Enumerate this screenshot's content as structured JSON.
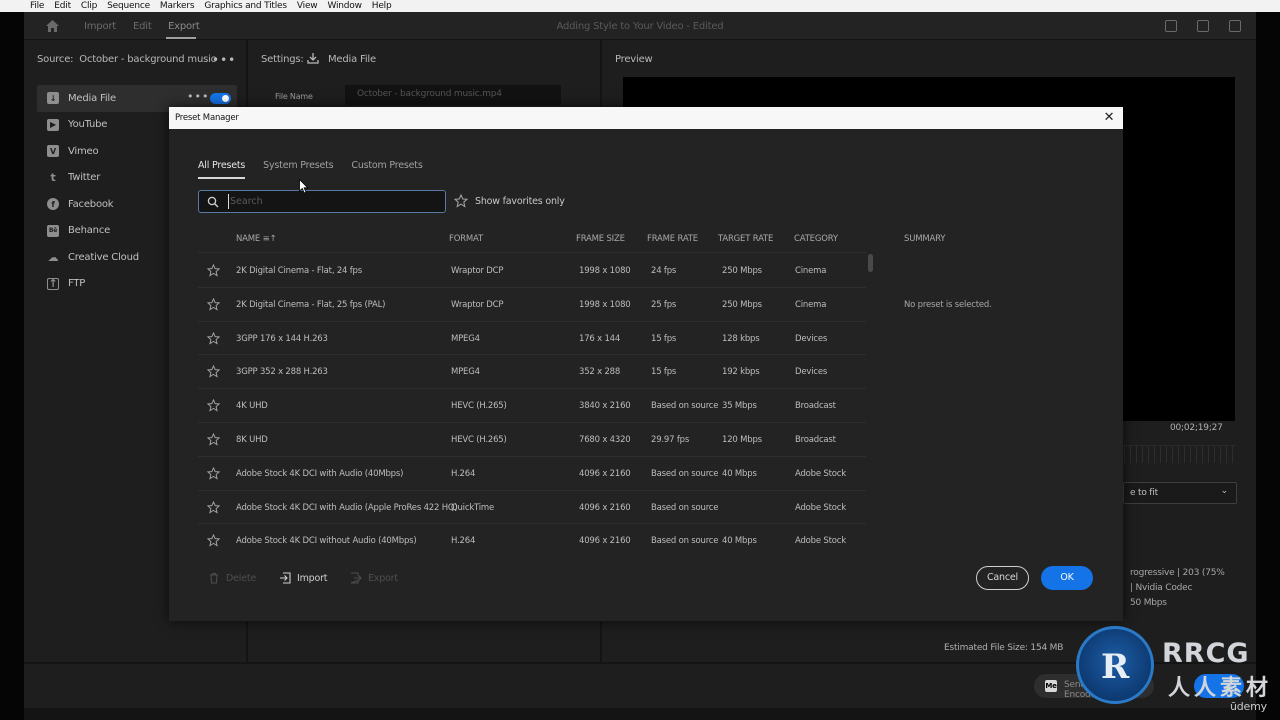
{
  "menubar": [
    "File",
    "Edit",
    "Clip",
    "Sequence",
    "Markers",
    "Graphics and Titles",
    "View",
    "Window",
    "Help"
  ],
  "topbar": {
    "tabs": [
      "Import",
      "Edit",
      "Export"
    ],
    "title": "Adding Style to Your Video - Edited"
  },
  "source": {
    "label": "Source:",
    "name": "October - background music",
    "destinations": [
      {
        "label": "Media File",
        "icon": "download-icon",
        "glyph": "↓"
      },
      {
        "label": "YouTube",
        "icon": "youtube-icon",
        "glyph": "▶"
      },
      {
        "label": "Vimeo",
        "icon": "vimeo-icon",
        "glyph": "V"
      },
      {
        "label": "Twitter",
        "icon": "twitter-icon",
        "glyph": "t"
      },
      {
        "label": "Facebook",
        "icon": "facebook-icon",
        "glyph": "f"
      },
      {
        "label": "Behance",
        "icon": "behance-icon",
        "glyph": "Bē"
      },
      {
        "label": "Creative Cloud",
        "icon": "creative-cloud-icon",
        "glyph": "☁"
      },
      {
        "label": "FTP",
        "icon": "ftp-upload-icon",
        "glyph": "↑"
      }
    ]
  },
  "settings": {
    "label": "Settings:",
    "value": "Media File",
    "file_name_label": "File Name",
    "file_name": "October - background music.mp4"
  },
  "preview": {
    "label": "Preview",
    "timecode": "00;02;19;27",
    "fit": "e to fit",
    "summary_lines": [
      "rogressive | 203 (75%",
      "| Nvidia Codec",
      "50 Mbps"
    ],
    "estimated_size": "Estimated File Size:   154 MB"
  },
  "bottombar": {
    "send_label": "Send to Media Encoder",
    "export_label": "Export"
  },
  "dialog": {
    "title": "Preset Manager",
    "tabs": [
      "All Presets",
      "System Presets",
      "Custom Presets"
    ],
    "search_placeholder": "Search",
    "favorites_label": "Show favorites only",
    "columns": {
      "name": "NAME ≡↑",
      "format": "FORMAT",
      "frame_size": "FRAME SIZE",
      "frame_rate": "FRAME RATE",
      "target_rate": "TARGET RATE",
      "category": "CATEGORY"
    },
    "summary_header": "SUMMARY",
    "summary_text": "No preset is selected.",
    "rows": [
      {
        "name": "2K Digital Cinema - Flat, 24 fps",
        "format": "Wraptor DCP",
        "size": "1998 x 1080",
        "rate": "24 fps",
        "target": "250 Mbps",
        "category": "Cinema"
      },
      {
        "name": "2K Digital Cinema - Flat, 25 fps (PAL)",
        "format": "Wraptor DCP",
        "size": "1998 x 1080",
        "rate": "25 fps",
        "target": "250 Mbps",
        "category": "Cinema"
      },
      {
        "name": "3GPP 176 x 144 H.263",
        "format": "MPEG4",
        "size": "176 x 144",
        "rate": "15 fps",
        "target": "128 kbps",
        "category": "Devices"
      },
      {
        "name": "3GPP 352 x 288 H.263",
        "format": "MPEG4",
        "size": "352 x 288",
        "rate": "15 fps",
        "target": "192 kbps",
        "category": "Devices"
      },
      {
        "name": "4K UHD",
        "format": "HEVC (H.265)",
        "size": "3840 x 2160",
        "rate": "Based on source",
        "target": "35 Mbps",
        "category": "Broadcast"
      },
      {
        "name": "8K UHD",
        "format": "HEVC (H.265)",
        "size": "7680 x 4320",
        "rate": "29.97 fps",
        "target": "120 Mbps",
        "category": "Broadcast"
      },
      {
        "name": "Adobe Stock 4K DCI with Audio (40Mbps)",
        "format": "H.264",
        "size": "4096 x 2160",
        "rate": "Based on source",
        "target": "40 Mbps",
        "category": "Adobe Stock"
      },
      {
        "name": "Adobe Stock 4K DCI with Audio (Apple ProRes 422 HQ)",
        "format": "QuickTime",
        "size": "4096 x 2160",
        "rate": "Based on source",
        "target": "",
        "category": "Adobe Stock"
      },
      {
        "name": "Adobe Stock 4K DCI without Audio (40Mbps)",
        "format": "H.264",
        "size": "4096 x 2160",
        "rate": "Based on source",
        "target": "40 Mbps",
        "category": "Adobe Stock"
      }
    ],
    "footer": {
      "delete": "Delete",
      "import": "Import",
      "export": "Export",
      "cancel": "Cancel",
      "ok": "OK"
    }
  },
  "watermark": {
    "logo": "R",
    "text": "RRCG",
    "cn": "人人素材"
  },
  "udemy": "ūdemy",
  "colors": {
    "accent": "#1473e6",
    "dialog_bg": "#232323",
    "app_bg": "#1e1e1e"
  }
}
